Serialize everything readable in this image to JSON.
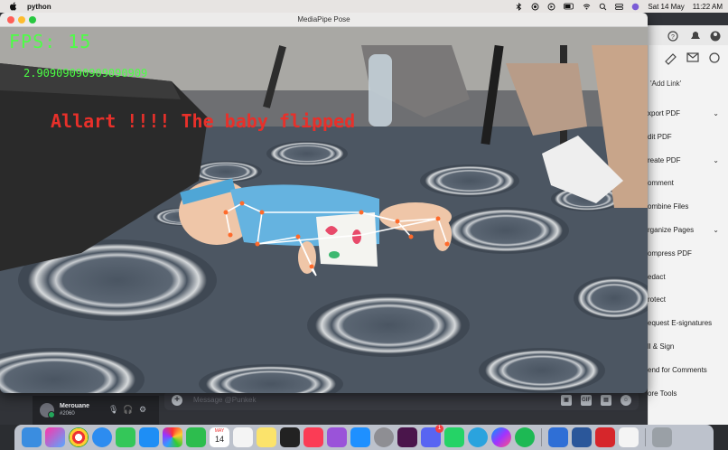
{
  "menubar": {
    "app_name": "python",
    "date": "Sat 14 May",
    "time": "11:22 AM"
  },
  "window": {
    "title": "MediaPipe Pose"
  },
  "overlay": {
    "fps_label": "FPS: 15",
    "fps_value": "2.90909090909090909",
    "alert_text": "Allart !!!! The baby flipped"
  },
  "acrobat": {
    "link_label": "'Add Link'",
    "items": [
      {
        "label": "xport PDF",
        "has_chevron": true
      },
      {
        "label": "dit PDF",
        "has_chevron": false
      },
      {
        "label": "reate PDF",
        "has_chevron": true
      },
      {
        "label": "omment",
        "has_chevron": false
      },
      {
        "label": "ombine Files",
        "has_chevron": false
      },
      {
        "label": "rganize Pages",
        "has_chevron": true
      },
      {
        "label": "ompress PDF",
        "has_chevron": false
      },
      {
        "label": "edact",
        "has_chevron": false
      },
      {
        "label": "rotect",
        "has_chevron": false
      },
      {
        "label": "equest E-signatures",
        "has_chevron": false
      },
      {
        "label": "ll & Sign",
        "has_chevron": false
      },
      {
        "label": "end for Comments",
        "has_chevron": false
      },
      {
        "label": "ore Tools",
        "has_chevron": false
      }
    ],
    "chevron_glyph": "⌄"
  },
  "discord": {
    "user_name": "Merouane",
    "user_tag": "#2060",
    "message_placeholder": "Message @Punkek",
    "tool_gif": "GIF"
  },
  "dock": {
    "calendar_day": "14",
    "calendar_month": "MAY",
    "discord_badge": "1"
  }
}
